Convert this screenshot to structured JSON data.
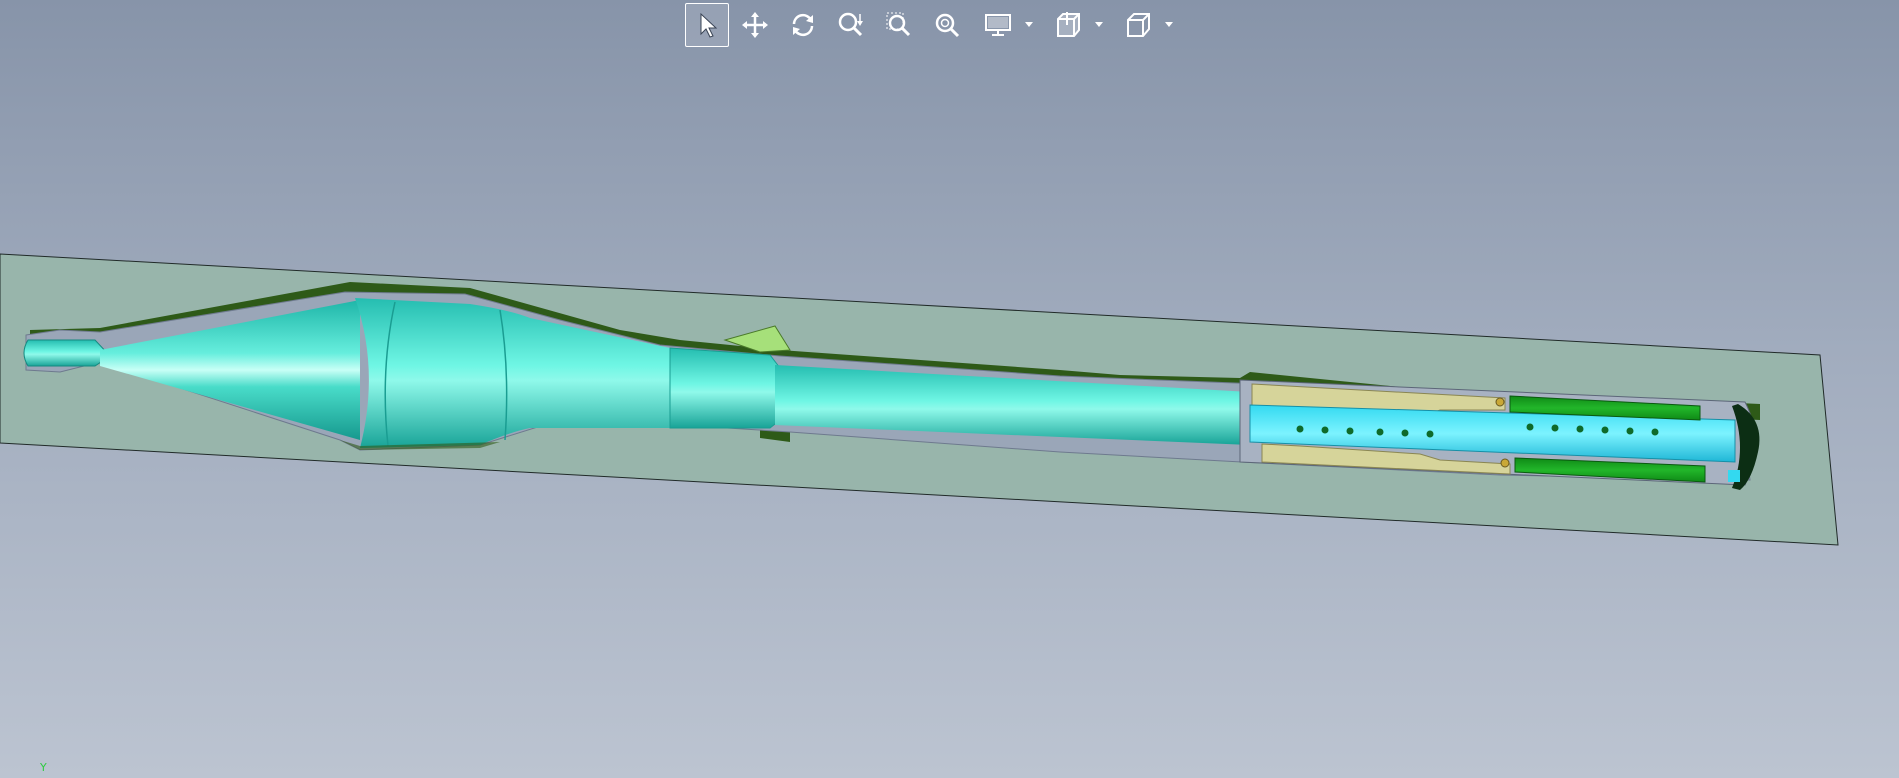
{
  "app": {
    "view": "3D section view"
  },
  "toolbar": {
    "tools": [
      {
        "name": "select",
        "icon": "cursor-arrow-icon",
        "active": true
      },
      {
        "name": "pan",
        "icon": "move-arrows-icon",
        "active": false
      },
      {
        "name": "rotate",
        "icon": "rotate-icon",
        "active": false
      },
      {
        "name": "zoom",
        "icon": "zoom-icon",
        "active": false
      },
      {
        "name": "zoom-window",
        "icon": "zoom-window-icon",
        "active": false
      },
      {
        "name": "zoom-fit",
        "icon": "zoom-fit-icon",
        "active": false
      },
      {
        "name": "display",
        "icon": "monitor-icon",
        "dropdown": true
      },
      {
        "name": "section",
        "icon": "section-plane-icon",
        "dropdown": true
      },
      {
        "name": "view-orientation",
        "icon": "cube-icon",
        "dropdown": true
      }
    ]
  },
  "axis": {
    "label": "Y",
    "color": "#2ecc40"
  },
  "colors": {
    "background_top": "#8794a9",
    "background_bottom": "#bcc4d1",
    "section_plane": "#98b5ab",
    "body_teal": "#2ed3c4",
    "body_highlight": "#9ffff0",
    "insert_tan": "#d6d49a",
    "spring_green": "#1aa51a",
    "shadow_green": "#2e5a18",
    "fin_green": "#a6e07a"
  }
}
